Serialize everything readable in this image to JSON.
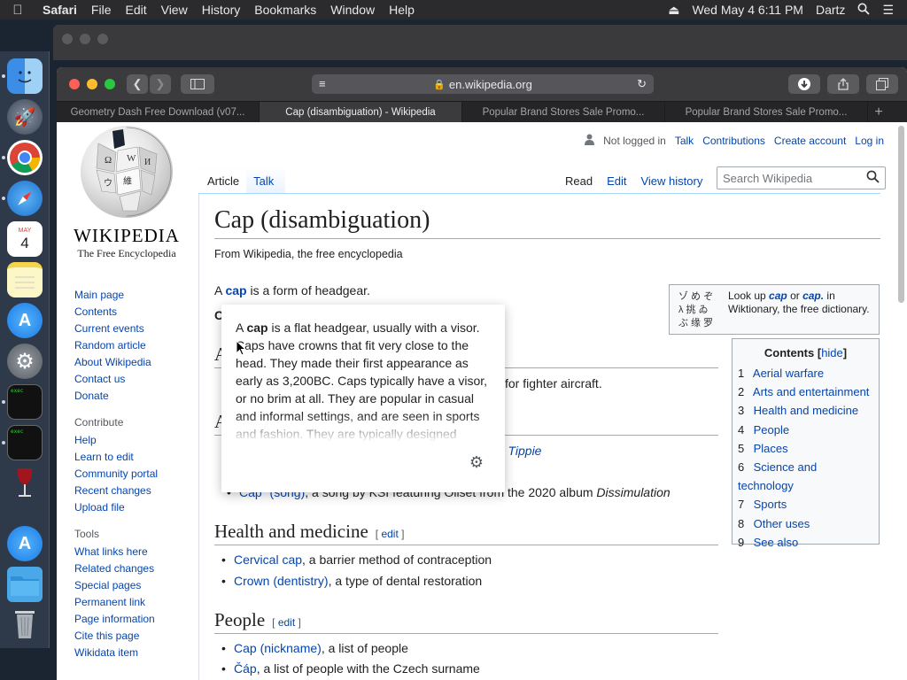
{
  "menubar": {
    "apple": "",
    "items": [
      "Safari",
      "File",
      "Edit",
      "View",
      "History",
      "Bookmarks",
      "Window",
      "Help"
    ],
    "clock": "Wed May 4  6:11 PM",
    "user": "Dartz"
  },
  "dock": {
    "apps": [
      "finder-icon",
      "launchpad-icon",
      "chrome-icon",
      "safari-icon",
      "calendar-icon",
      "notes-icon",
      "app-store-icon",
      "system-preferences-icon",
      "terminal-icon",
      "terminal-icon",
      "wine-icon",
      "app-store-icon",
      "folder-icon",
      "trash-icon"
    ],
    "calendar_month": "MAY",
    "calendar_day": "4",
    "terminal_label": "exec"
  },
  "safari": {
    "url": "en.wikipedia.org",
    "tabs": [
      {
        "label": "Geometry Dash Free Download (v07...",
        "active": false
      },
      {
        "label": "Cap (disambiguation) - Wikipedia",
        "active": true
      },
      {
        "label": "Popular Brand Stores Sale Promo...",
        "active": false
      },
      {
        "label": "Popular Brand Stores Sale Promo...",
        "active": false
      }
    ]
  },
  "wiki": {
    "wordmark": "WIKIPEDIA",
    "tagline": "The Free Encyclopedia",
    "personal": {
      "not_logged": "Not logged in",
      "talk": "Talk",
      "contributions": "Contributions",
      "create": "Create account",
      "login": "Log in"
    },
    "nav": [
      "Main page",
      "Contents",
      "Current events",
      "Random article",
      "About Wikipedia",
      "Contact us",
      "Donate"
    ],
    "contribute_heading": "Contribute",
    "contribute": [
      "Help",
      "Learn to edit",
      "Community portal",
      "Recent changes",
      "Upload file"
    ],
    "tools_heading": "Tools",
    "tools": [
      "What links here",
      "Related changes",
      "Special pages",
      "Permanent link",
      "Page information",
      "Cite this page",
      "Wikidata item"
    ],
    "tabs_left": [
      "Article",
      "Talk"
    ],
    "tabs_right": [
      "Read",
      "Edit",
      "View history"
    ],
    "search_placeholder": "Search Wikipedia",
    "title": "Cap (disambiguation)",
    "from": "From Wikipedia, the free encyclopedia",
    "intro_pre": "A ",
    "intro_link": "cap",
    "intro_post": " is a form of headgear.",
    "obscured_c": "C",
    "obscured_a1": "A",
    "obscured_a2": "A",
    "aerial_tail": "for fighter aircraft.",
    "arts_tail": "nd Tippie",
    "song_link": "Cap\" (song)",
    "song_text": ", a song by KSI featuring Oliset from the 2020 album ",
    "song_album": "Dissimulation",
    "h_health": "Health and medicine",
    "edit": "edit",
    "health_items": [
      {
        "link": "Cervical cap",
        "text": ", a barrier method of contraception"
      },
      {
        "link": "Crown (dentistry)",
        "text": ", a type of dental restoration"
      }
    ],
    "h_people": "People",
    "people_items": [
      {
        "link": "Cap (nickname)",
        "text": ", a list of people"
      },
      {
        "link": "Čáp",
        "text": ", a list of people with the Czech surname"
      }
    ],
    "wikt_text_a": "Look up ",
    "wikt_cap1": "cap",
    "wikt_or": " or ",
    "wikt_cap2": "cap.",
    "wikt_text_b": " in Wiktionary, the free dictionary.",
    "wikt_glyphs": "ゾ め ぞ\nλ 挑 ゐ\nぶ 缘 罗",
    "toc_title": "Contents",
    "toc_hide": "hide",
    "toc": [
      {
        "n": "1",
        "t": "Aerial warfare"
      },
      {
        "n": "2",
        "t": "Arts and entertainment"
      },
      {
        "n": "3",
        "t": "Health and medicine"
      },
      {
        "n": "4",
        "t": "People"
      },
      {
        "n": "5",
        "t": "Places"
      },
      {
        "n": "6",
        "t": "Science and technology"
      },
      {
        "n": "7",
        "t": "Sports"
      },
      {
        "n": "8",
        "t": "Other uses"
      },
      {
        "n": "9",
        "t": "See also"
      }
    ],
    "card_pre": "A ",
    "card_bold": "cap",
    "card_text": " is a flat headgear, usually with a visor. Caps have crowns that fit very close to the head. They made their first appearance as early as 3,200BC. Caps typically have a visor, or no brim at all. They are popular in casual and informal settings, and are seen in sports and fashion. They are typically designed"
  }
}
